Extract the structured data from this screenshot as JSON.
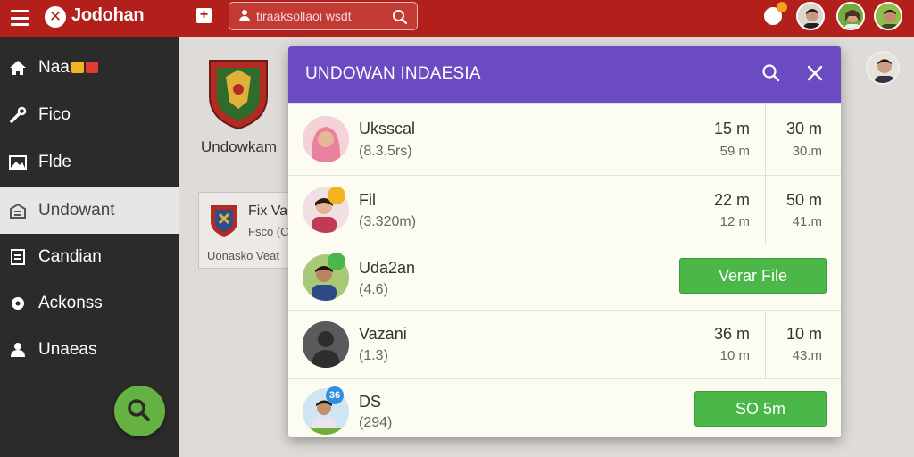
{
  "app": {
    "title": "Jodohan"
  },
  "search": {
    "placeholder": "tiraaksollaoi wsdt"
  },
  "sidebar": {
    "items": [
      {
        "label": "Naa",
        "icon": "home-icon",
        "active": false
      },
      {
        "label": "Fico",
        "icon": "tools-icon",
        "active": false
      },
      {
        "label": "Flde",
        "icon": "image-icon",
        "active": false
      },
      {
        "label": "Undowant",
        "icon": "inbox-icon",
        "active": true
      },
      {
        "label": "Candian",
        "icon": "document-icon",
        "active": false
      },
      {
        "label": "Ackonss",
        "icon": "location-icon",
        "active": false
      },
      {
        "label": "Unaeas",
        "icon": "user-icon",
        "active": false
      }
    ]
  },
  "background": {
    "title": "Undowkam",
    "card": {
      "title": "Fix Va",
      "subtitle": "Fsco (C",
      "footer": "Uonasko  Veat"
    }
  },
  "modal": {
    "title": "UNDOWAN INDAESIA",
    "rows": [
      {
        "name": "Uksscal",
        "sub": "(8.3.5rs)",
        "c1_top": "15 m",
        "c1_bot": "59 m",
        "c2_top": "30 m",
        "c2_bot": "30.m"
      },
      {
        "name": "Fil",
        "sub": "(3.320m)",
        "c1_top": "22 m",
        "c1_bot": "12 m",
        "c2_top": "50 m",
        "c2_bot": "41.m",
        "badge": ""
      },
      {
        "name": "Uda2an",
        "sub": "(4.6)",
        "button": "Verar File",
        "badge": ""
      },
      {
        "name": "Vazani",
        "sub": "(1.3)",
        "c1_top": "36 m",
        "c1_bot": "10 m",
        "c2_top": "10 m",
        "c2_bot": "43.m"
      },
      {
        "name": "DS",
        "sub": "(294)",
        "button": "SO 5m",
        "badge": "36"
      }
    ]
  },
  "colors": {
    "topbar": "#b3201c",
    "sidebar": "#2b2b2b",
    "modal_header": "#6a4bc1",
    "accent_green": "#4cb749"
  }
}
